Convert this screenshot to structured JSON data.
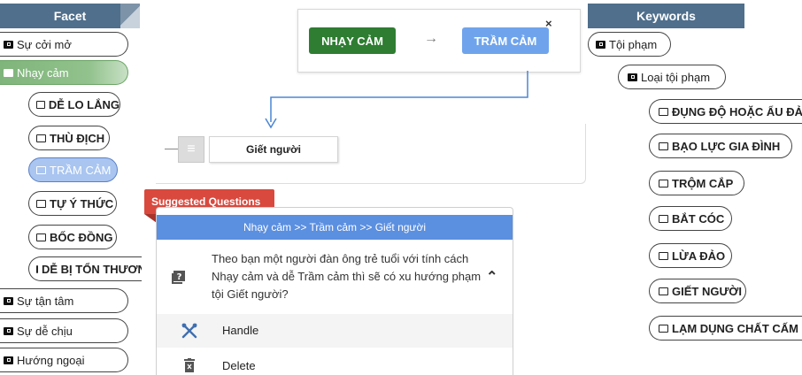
{
  "facet": {
    "header": "Facet",
    "items": [
      {
        "label": "Sự cởi mở"
      },
      {
        "label": "Nhạy cảm"
      },
      {
        "label": "DỄ LO LẮNG"
      },
      {
        "label": "THÙ ĐỊCH"
      },
      {
        "label": "TRẦM CẢM"
      },
      {
        "label": "TỰ Ý THỨC"
      },
      {
        "label": "BỐC ĐỒNG"
      },
      {
        "label": "DỄ BỊ TỔN THƯƠNG"
      },
      {
        "label": "Sự tận tâm"
      },
      {
        "label": "Sự dễ chịu"
      },
      {
        "label": "Hướng ngoại"
      }
    ]
  },
  "flow": {
    "from_tag": "NHẠY CẢM",
    "arrow": "→",
    "to_tag": "TRẦM CẢM",
    "close": "×",
    "node_label": "Giết người",
    "handle_icon": "≡",
    "colors": {
      "from": "#2e7d32",
      "to": "#6fa4ec",
      "connector": "#4a86d4"
    }
  },
  "suggested": {
    "tab_label": "Suggested Questions",
    "breadcrumb": "Nhạy cảm >> Trầm cảm >> Giết người",
    "question": "Theo bạn một người đàn ông trẻ tuổi với tính cách Nhạy cảm và dễ Trầm cảm thì sẽ có xu hướng phạm tội Giết người?",
    "collapse_icon": "⌃",
    "menu": [
      {
        "icon": "tools-icon",
        "label": "Handle"
      },
      {
        "icon": "trash-icon",
        "label": "Delete"
      }
    ],
    "colors": {
      "tab": "#d9493e",
      "header": "#5b8fe0"
    }
  },
  "keywords": {
    "header": "Keywords",
    "root": "Tội phạm",
    "group": "Loại tội phạm",
    "items": [
      {
        "label": "ĐỤNG ĐỘ HOẶC ẨU ĐẢ"
      },
      {
        "label": "BẠO LỰC GIA ĐÌNH"
      },
      {
        "label": "TRỘM CẮP"
      },
      {
        "label": "BẮT CÓC"
      },
      {
        "label": "LỪA ĐẢO"
      },
      {
        "label": "GIẾT NGƯỜI"
      },
      {
        "label": "LẠM DỤNG CHẤT CẤM"
      }
    ]
  }
}
